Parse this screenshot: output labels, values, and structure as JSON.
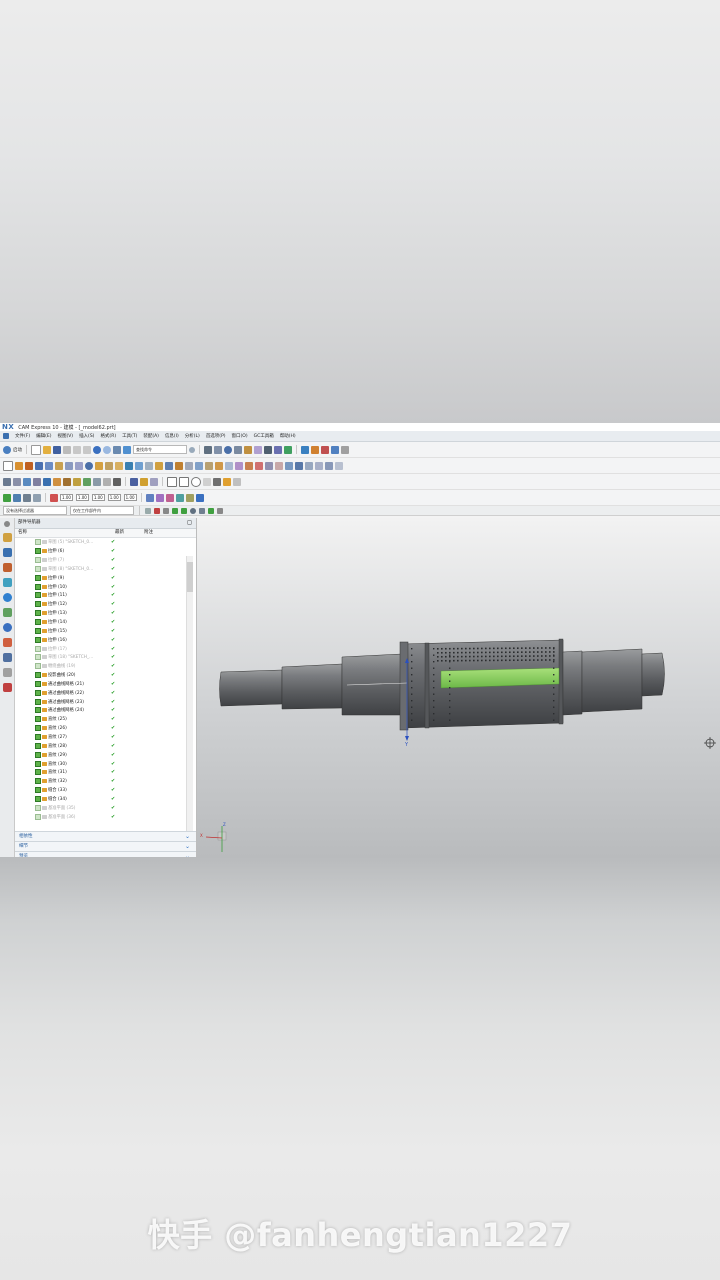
{
  "window": {
    "logo": "NX",
    "title": "CAM Express 10 - 建模 - [_model62.prt]"
  },
  "menu": [
    "文件(F)",
    "编辑(E)",
    "视图(V)",
    "插入(S)",
    "格式(R)",
    "工具(T)",
    "装配(A)",
    "信息(I)",
    "分析(L)",
    "首选项(P)",
    "窗口(O)",
    "GC工具箱",
    "帮助(H)"
  ],
  "toolbar": {
    "start_label": "启动",
    "command_finder_placeholder": "查找命令",
    "scale_values": [
      "1.00",
      "1.00",
      "1.00",
      "1.00",
      "1.00"
    ]
  },
  "filterbar": {
    "selection_filter": "没有选择过滤器",
    "scope": "仅在工作部件内"
  },
  "navigator": {
    "title": "部件导航器",
    "columns": [
      "名称",
      "最新",
      "附注"
    ],
    "rows": [
      {
        "name": "草图 (5) \"SKETCH_0...",
        "dim": true
      },
      {
        "name": "拉伸 (6)",
        "dim": false
      },
      {
        "name": "拉伸 (7)",
        "dim": true
      },
      {
        "name": "草图 (8) \"SKETCH_0...",
        "dim": true
      },
      {
        "name": "拉伸 (9)",
        "dim": false
      },
      {
        "name": "拉伸 (10)",
        "dim": false
      },
      {
        "name": "拉伸 (11)",
        "dim": false
      },
      {
        "name": "拉伸 (12)",
        "dim": false
      },
      {
        "name": "拉伸 (13)",
        "dim": false
      },
      {
        "name": "拉伸 (14)",
        "dim": false
      },
      {
        "name": "拉伸 (15)",
        "dim": false
      },
      {
        "name": "拉伸 (16)",
        "dim": false
      },
      {
        "name": "拉伸 (17)",
        "dim": true
      },
      {
        "name": "草图 (18) \"SKETCH_...",
        "dim": true
      },
      {
        "name": "缠绕曲线 (19)",
        "dim": true
      },
      {
        "name": "投影曲线 (20)",
        "dim": false
      },
      {
        "name": "通过曲线网格 (21)",
        "dim": false
      },
      {
        "name": "通过曲线网格 (22)",
        "dim": false
      },
      {
        "name": "通过曲线网格 (23)",
        "dim": false
      },
      {
        "name": "通过曲线网格 (24)",
        "dim": false
      },
      {
        "name": "直纹 (25)",
        "dim": false
      },
      {
        "name": "直纹 (26)",
        "dim": false
      },
      {
        "name": "直纹 (27)",
        "dim": false
      },
      {
        "name": "直纹 (28)",
        "dim": false
      },
      {
        "name": "直纹 (29)",
        "dim": false
      },
      {
        "name": "直纹 (30)",
        "dim": false
      },
      {
        "name": "直纹 (31)",
        "dim": false
      },
      {
        "name": "直纹 (32)",
        "dim": false
      },
      {
        "name": "缝合 (33)",
        "dim": false
      },
      {
        "name": "缝合 (34)",
        "dim": false
      },
      {
        "name": "基准平面 (35)",
        "dim": true
      },
      {
        "name": "基准平面 (36)",
        "dim": true
      }
    ],
    "panels": [
      "相依性",
      "细节",
      "预览"
    ]
  },
  "viewport": {
    "axis_y": "Y",
    "axis_z": "Z",
    "axis_x": "X"
  },
  "watermark": "快手 @fanhengtian1227"
}
